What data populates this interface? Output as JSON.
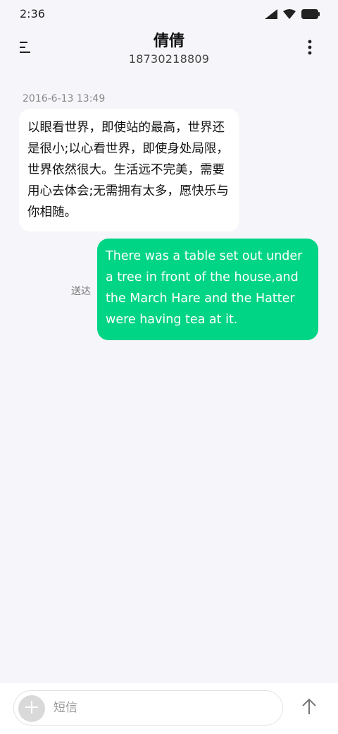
{
  "status_bar": {
    "time": "2:36"
  },
  "header": {
    "contact_name": "倩倩",
    "contact_number": "18730218809"
  },
  "messages": [
    {
      "direction": "incoming",
      "timestamp": "2016-6-13 13:49",
      "text": "以眼看世界，即使站的最高，世界还是很小;以心看世界，即使身处局限，世界依然很大。生活远不完美，需要用心去体会;无需拥有太多，愿快乐与你相随。"
    },
    {
      "direction": "outgoing",
      "status": "送达",
      "text": "There was a table set out under a tree in front of the house,and the March Hare and the Hatter were having tea at it."
    }
  ],
  "composer": {
    "placeholder": "短信"
  },
  "icons": {
    "menu": "menu-icon",
    "more": "more-vertical-icon",
    "add": "plus-icon",
    "send": "arrow-up-icon",
    "signal": "signal-icon",
    "wifi": "wifi-icon",
    "battery": "battery-icon"
  },
  "colors": {
    "background": "#f6f5fa",
    "incoming_bubble": "#ffffff",
    "outgoing_bubble": "#00d485"
  }
}
